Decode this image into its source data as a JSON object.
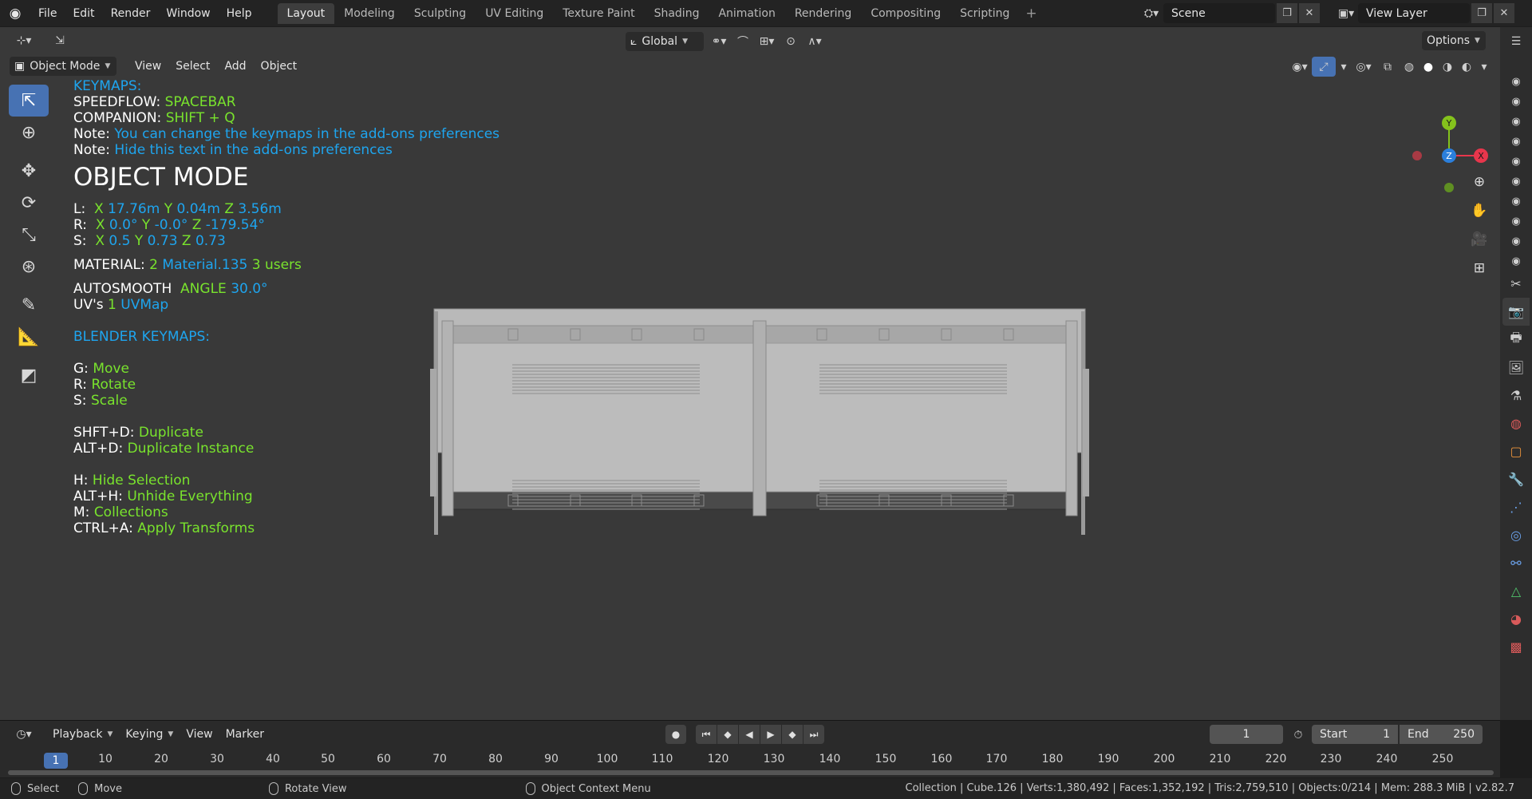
{
  "menu": [
    "File",
    "Edit",
    "Render",
    "Window",
    "Help"
  ],
  "workspaces": [
    {
      "label": "Layout",
      "active": true
    },
    {
      "label": "Modeling"
    },
    {
      "label": "Sculpting"
    },
    {
      "label": "UV Editing"
    },
    {
      "label": "Texture Paint"
    },
    {
      "label": "Shading"
    },
    {
      "label": "Animation"
    },
    {
      "label": "Rendering"
    },
    {
      "label": "Compositing"
    },
    {
      "label": "Scripting"
    }
  ],
  "scene": {
    "name": "Scene"
  },
  "view_layer": {
    "name": "View Layer"
  },
  "header": {
    "transform_orientation": "Global",
    "options": "Options"
  },
  "viewport_menu": {
    "mode": "Object Mode",
    "items": [
      "View",
      "Select",
      "Add",
      "Object"
    ]
  },
  "overlay": {
    "keymaps": "KEYMAPS:",
    "speedflow_label": "SPEEDFLOW:",
    "speedflow_key": "SPACEBAR",
    "companion_label": "COMPANION:",
    "companion_key": "SHIFT + Q",
    "note_label": "Note:",
    "note1": "You can change the keymaps in the add-ons preferences",
    "note2": "Hide this text in the add-ons preferences",
    "mode_title": "OBJECT MODE",
    "loc": {
      "label": "L:",
      "x": "17.76m",
      "y": "0.04m",
      "z": "3.56m"
    },
    "rot": {
      "label": "R:",
      "x": "0.0°",
      "y": "-0.0°",
      "z": "-179.54°"
    },
    "scale": {
      "label": "S:",
      "x": "0.5",
      "y": "0.73",
      "z": "0.73"
    },
    "axis": {
      "x": "X",
      "y": "Y",
      "z": "Z"
    },
    "material": {
      "label": "MATERIAL:",
      "count": "2",
      "name": "Material.135",
      "users": "3 users"
    },
    "autosmooth": {
      "label": "AUTOSMOOTH",
      "angle_label": "ANGLE",
      "angle": "30.0°"
    },
    "uvs": {
      "label": "UV's",
      "count": "1",
      "name": "UVMap"
    },
    "blender_keymaps": "BLENDER KEYMAPS:",
    "shortcuts": [
      {
        "key": "G:",
        "action": "Move"
      },
      {
        "key": "R:",
        "action": "Rotate"
      },
      {
        "key": "S:",
        "action": "Scale"
      },
      {
        "key": "SHFT+D:",
        "action": "Duplicate"
      },
      {
        "key": "ALT+D:",
        "action": "Duplicate Instance"
      },
      {
        "key": "H:",
        "action": "Hide Selection"
      },
      {
        "key": "ALT+H:",
        "action": "Unhide Everything"
      },
      {
        "key": "M:",
        "action": "Collections"
      },
      {
        "key": "CTRL+A:",
        "action": "Apply Transforms"
      }
    ]
  },
  "gizmo": {
    "x": "X",
    "y": "Y",
    "z": "Z"
  },
  "timeline": {
    "menus": [
      "Playback",
      "Keying",
      "View",
      "Marker"
    ],
    "current_frame": "1",
    "start_label": "Start",
    "start": "1",
    "end_label": "End",
    "end": "250",
    "ruler": [
      "10",
      "20",
      "30",
      "40",
      "50",
      "60",
      "70",
      "80",
      "90",
      "100",
      "110",
      "120",
      "130",
      "140",
      "150",
      "160",
      "170",
      "180",
      "190",
      "200",
      "210",
      "220",
      "230",
      "240",
      "250"
    ]
  },
  "status": {
    "select": "Select",
    "move": "Move",
    "rotate": "Rotate View",
    "context": "Object Context Menu",
    "stats": "Collection | Cube.126 | Verts:1,380,492 | Faces:1,352,192 | Tris:2,759,510 | Objects:0/214 | Mem: 288.3 MiB | v2.82.7"
  },
  "colors": {
    "accent": "#4772b3",
    "overlay_blue": "#1ea5ef",
    "overlay_green": "#79e32d",
    "axis_x": "#e8364c",
    "axis_y": "#84c21c",
    "axis_z": "#2b7fdc"
  }
}
